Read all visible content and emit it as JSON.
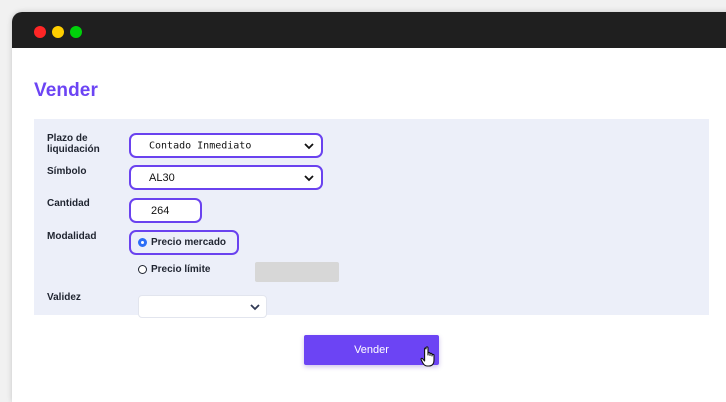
{
  "window": {
    "title_dots": [
      "red",
      "yellow",
      "green"
    ]
  },
  "page": {
    "title": "Vender"
  },
  "form": {
    "settlement_label_line1": "Plazo de",
    "settlement_label_line2": "liquidación",
    "settlement_value": "Contado Inmediato",
    "symbol_label": "Símbolo",
    "symbol_value": "AL30",
    "quantity_label": "Cantidad",
    "quantity_value": "264",
    "mode_label": "Modalidad",
    "market_price_label": "Precio mercado",
    "limit_price_label": "Precio límite",
    "validity_label": "Validez",
    "validity_value": ""
  },
  "actions": {
    "submit_label": "Vender"
  },
  "colors": {
    "accent": "#6c44f4",
    "highlight": "#6a42ef",
    "panel": "#eceff9",
    "titlebar": "#1f1f1f",
    "radio": "#2c6ef7"
  },
  "icons": {
    "dropdown": "chevron-down-icon",
    "cursor": "hand-pointer-icon"
  }
}
